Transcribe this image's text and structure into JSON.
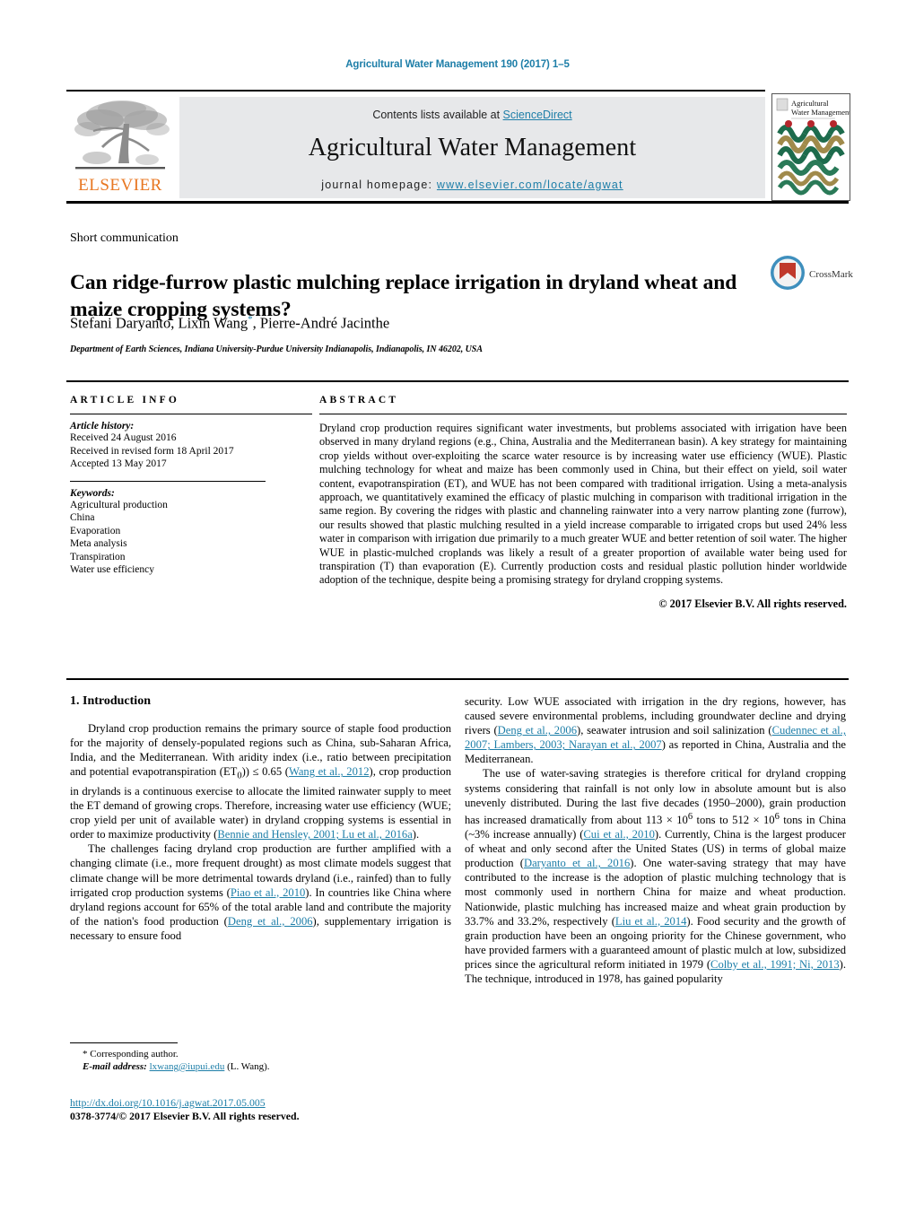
{
  "running_head": "Agricultural Water Management 190 (2017) 1–5",
  "masthead": {
    "publisher_name": "ELSEVIER",
    "contents_prefix": "Contents lists available at ",
    "sciencedirect": "ScienceDirect",
    "journal_title": "Agricultural Water Management",
    "homepage_prefix": "journal homepage: ",
    "homepage_url": "www.elsevier.com/locate/agwat",
    "cover_title_line1": "Agricultural",
    "cover_title_line2": "Water Management"
  },
  "article": {
    "type_label": "Short communication",
    "title": "Can ridge-furrow plastic mulching replace irrigation in dryland wheat and maize cropping systems?",
    "authors": "Stefani Daryanto, Lixin Wang",
    "authors_tail": ", Pierre-André Jacinthe",
    "corresponding_marker": "*",
    "affiliation": "Department of Earth Sciences, Indiana University-Purdue University Indianapolis, Indianapolis, IN 46202, USA",
    "crossmark_label": "CrossMark"
  },
  "article_info": {
    "heading": "ARTICLE INFO",
    "history_label": "Article history:",
    "history": [
      "Received 24 August 2016",
      "Received in revised form 18 April 2017",
      "Accepted 13 May 2017"
    ],
    "keywords_label": "Keywords:",
    "keywords": [
      "Agricultural production",
      "China",
      "Evaporation",
      "Meta analysis",
      "Transpiration",
      "Water use efficiency"
    ]
  },
  "abstract": {
    "heading": "ABSTRACT",
    "text": "Dryland crop production requires significant water investments, but problems associated with irrigation have been observed in many dryland regions (e.g., China, Australia and the Mediterranean basin). A key strategy for maintaining crop yields without over-exploiting the scarce water resource is by increasing water use efficiency (WUE). Plastic mulching technology for wheat and maize has been commonly used in China, but their effect on yield, soil water content, evapotranspiration (ET), and WUE has not been compared with traditional irrigation. Using a meta-analysis approach, we quantitatively examined the efficacy of plastic mulching in comparison with traditional irrigation in the same region. By covering the ridges with plastic and channeling rainwater into a very narrow planting zone (furrow), our results showed that plastic mulching resulted in a yield increase comparable to irrigated crops but used 24% less water in comparison with irrigation due primarily to a much greater WUE and better retention of soil water. The higher WUE in plastic-mulched croplands was likely a result of a greater proportion of available water being used for transpiration (T) than evaporation (E). Currently production costs and residual plastic pollution hinder worldwide adoption of the technique, despite being a promising strategy for dryland cropping systems.",
    "copyright": "© 2017 Elsevier B.V. All rights reserved."
  },
  "body": {
    "section_heading": "1. Introduction",
    "left_paragraphs": [
      {
        "runs": [
          {
            "t": "Dryland crop production remains the primary source of staple food production for the majority of densely-populated regions such as China, sub-Saharan Africa, India, and the Mediterranean. With aridity index (i.e., ratio between precipitation and potential evapotranspiration (ET"
          },
          {
            "t": "0",
            "k": "sub"
          },
          {
            "t": ")) ≤ 0.65 ("
          },
          {
            "t": "Wang et al., 2012",
            "k": "ref"
          },
          {
            "t": "), crop production in drylands is a continuous exercise to allocate the limited rainwater supply to meet the ET demand of growing crops. Therefore, increasing water use efficiency (WUE; crop yield per unit of available water) in dryland cropping systems is essential in order to maximize productivity ("
          },
          {
            "t": "Bennie and Hensley, 2001; Lu et al., 2016a",
            "k": "ref"
          },
          {
            "t": ")."
          }
        ]
      },
      {
        "runs": [
          {
            "t": "The challenges facing dryland crop production are further amplified with a changing climate (i.e., more frequent drought) as most climate models suggest that climate change will be more detrimental towards dryland (i.e., rainfed) than to fully irrigated crop production systems ("
          },
          {
            "t": "Piao et al., 2010",
            "k": "ref"
          },
          {
            "t": "). In countries like China where dryland regions account for 65% of the total arable land and contribute the majority of the nation's food production ("
          },
          {
            "t": "Deng et al., 2006",
            "k": "ref"
          },
          {
            "t": "), supplementary irrigation is necessary to ensure food"
          }
        ]
      }
    ],
    "right_paragraphs": [
      {
        "runs": [
          {
            "t": "security. Low WUE associated with irrigation in the dry regions, however, has caused severe environmental problems, including groundwater decline and drying rivers ("
          },
          {
            "t": "Deng et al., 2006",
            "k": "ref"
          },
          {
            "t": "), seawater intrusion and soil salinization ("
          },
          {
            "t": "Cudennec et al., 2007; Lambers, 2003; Narayan et al., 2007",
            "k": "ref"
          },
          {
            "t": ") as reported in China, Australia and the Mediterranean."
          }
        ],
        "no_indent": true
      },
      {
        "runs": [
          {
            "t": "The use of water-saving strategies is therefore critical for dryland cropping systems considering that rainfall is not only low in absolute amount but is also unevenly distributed. During the last five decades (1950–2000), grain production has increased dramatically from about 113 × 10"
          },
          {
            "t": "6",
            "k": "sup"
          },
          {
            "t": " tons to 512 × 10"
          },
          {
            "t": "6",
            "k": "sup"
          },
          {
            "t": " tons in China (~3% increase annually) ("
          },
          {
            "t": "Cui et al., 2010",
            "k": "ref"
          },
          {
            "t": "). Currently, China is the largest producer of wheat and only second after the United States (US) in terms of global maize production ("
          },
          {
            "t": "Daryanto et al., 2016",
            "k": "ref"
          },
          {
            "t": "). One water-saving strategy that may have contributed to the increase is the adoption of plastic mulching technology that is most commonly used in northern China for maize and wheat production. Nationwide, plastic mulching has increased maize and wheat grain production by 33.7% and 33.2%, respectively ("
          },
          {
            "t": "Liu et al., 2014",
            "k": "ref"
          },
          {
            "t": "). Food security and the growth of grain production have been an ongoing priority for the Chinese government, who have provided farmers with a guaranteed amount of plastic mulch at low, subsidized prices since the agricultural reform initiated in 1979 ("
          },
          {
            "t": "Colby et al., 1991; Ni, 2013",
            "k": "ref"
          },
          {
            "t": "). The technique, introduced in 1978, has gained popularity"
          }
        ]
      }
    ]
  },
  "footer": {
    "corresponding_marker": "*",
    "corresponding_text": "Corresponding author.",
    "email_label": "E-mail address:",
    "email": "lxwang@iupui.edu",
    "email_owner": "(L. Wang).",
    "doi": "http://dx.doi.org/10.1016/j.agwat.2017.05.005",
    "issn_line": "0378-3774/© 2017 Elsevier B.V. All rights reserved."
  },
  "colors": {
    "link": "#1d7ea8",
    "elsevier_orange": "#e87722",
    "band_gray": "#e7e8ea"
  }
}
